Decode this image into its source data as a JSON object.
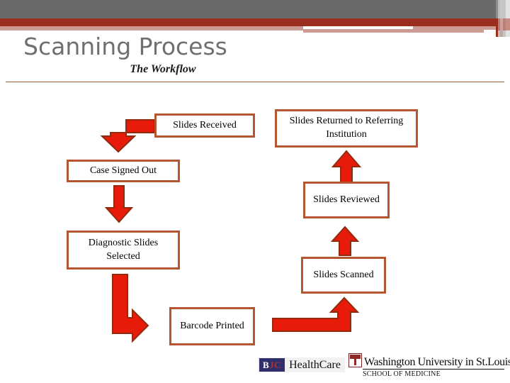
{
  "slide": {
    "title": "Scanning Process",
    "subtitle": "The Workflow"
  },
  "theme": {
    "band_gray": "#6a6a6a",
    "band_dark_red": "#9b2d1f",
    "band_light_red": "#cc9b94",
    "rule_color": "#9c5b3a",
    "node_border": "#b4562f",
    "arrow_fill": "#e81b0b",
    "arrow_outline": "#8f2c10",
    "title_color": "#6f6f6f"
  },
  "flowchart": {
    "nodes": [
      {
        "id": "slides-received",
        "label": "Slides Received"
      },
      {
        "id": "case-signed-out",
        "label": "Case Signed Out"
      },
      {
        "id": "diagnostic-slides",
        "label": "Diagnostic Slides Selected"
      },
      {
        "id": "barcode-printed",
        "label": "Barcode Printed"
      },
      {
        "id": "slides-scanned",
        "label": "Slides Scanned"
      },
      {
        "id": "slides-reviewed",
        "label": "Slides Reviewed"
      },
      {
        "id": "slides-returned",
        "label": "Slides Returned to Referring Institution"
      }
    ],
    "arrows": [
      {
        "id": "arrow-received-to-signed-out",
        "from": "slides-received",
        "to": "case-signed-out",
        "shape": "elbow-left-down"
      },
      {
        "id": "arrow-signed-out-to-diagnostic",
        "from": "case-signed-out",
        "to": "diagnostic-slides",
        "shape": "down"
      },
      {
        "id": "arrow-diagnostic-to-barcode",
        "from": "diagnostic-slides",
        "to": "barcode-printed",
        "shape": "elbow-down-right"
      },
      {
        "id": "arrow-barcode-to-scanned",
        "from": "barcode-printed",
        "to": "slides-scanned",
        "shape": "elbow-right-up"
      },
      {
        "id": "arrow-scanned-to-reviewed",
        "from": "slides-scanned",
        "to": "slides-reviewed",
        "shape": "up"
      },
      {
        "id": "arrow-reviewed-to-returned",
        "from": "slides-reviewed",
        "to": "slides-returned",
        "shape": "up"
      }
    ]
  },
  "footer": {
    "bjc": {
      "mark_b": "B",
      "mark_jc": "JC",
      "wordmark": "HealthCare"
    },
    "wustl": {
      "name": "Washington University in St.Louis",
      "sub": "SCHOOL OF MEDICINE"
    }
  }
}
